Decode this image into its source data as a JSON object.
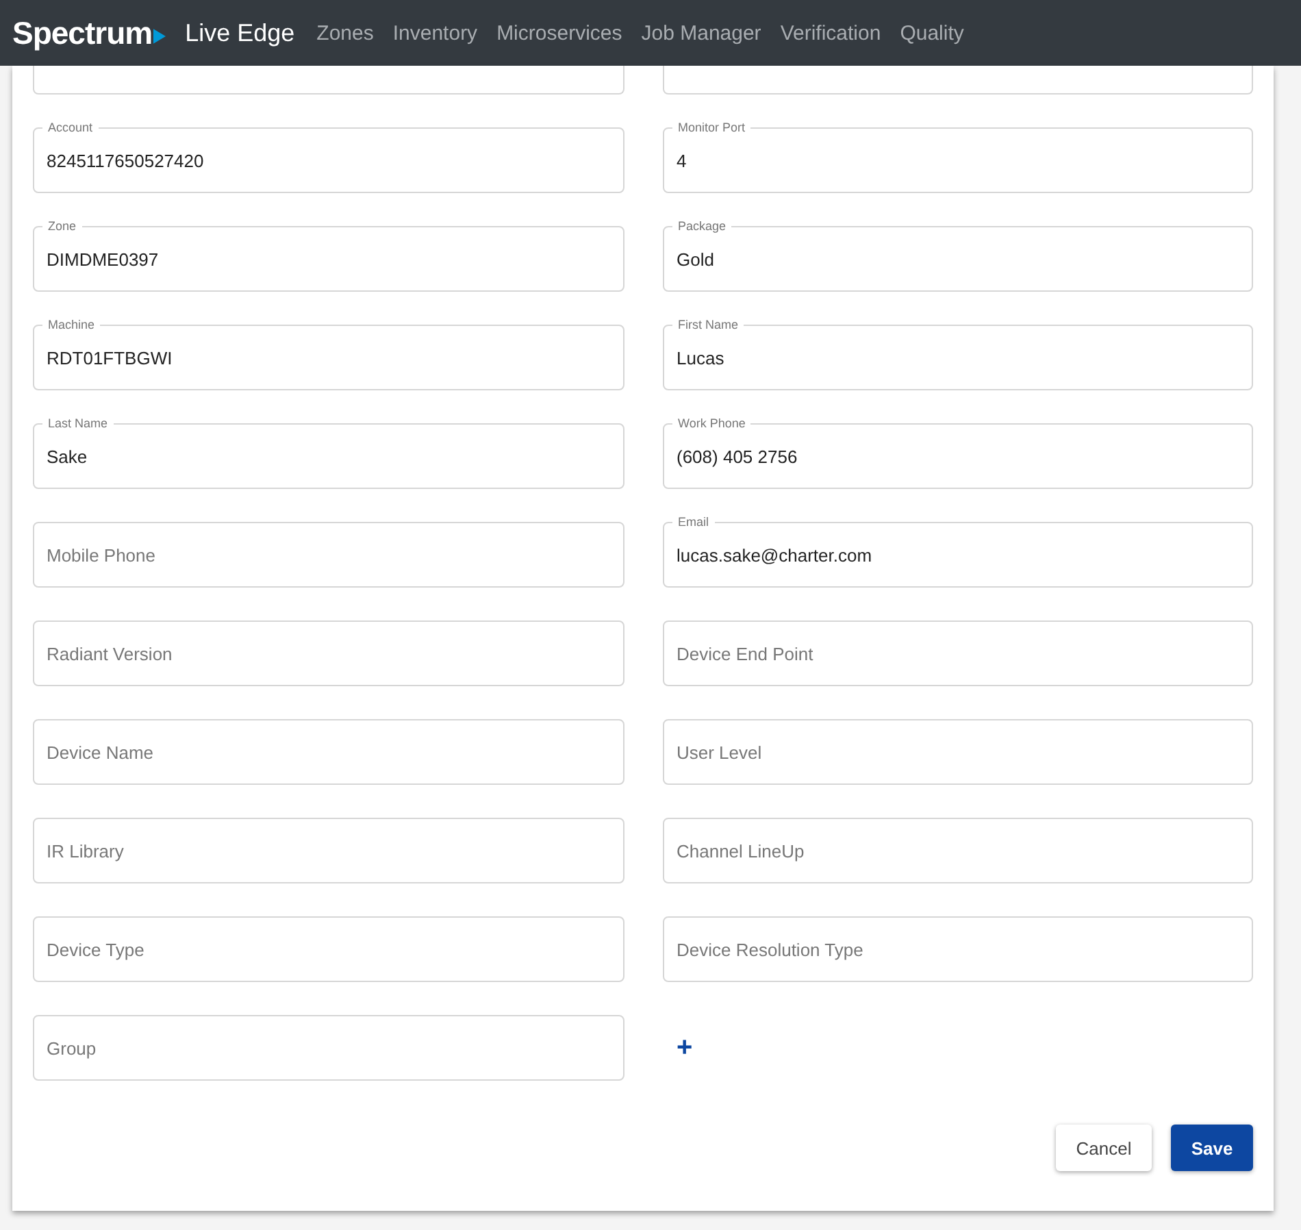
{
  "navbar": {
    "brand": "Spectrum",
    "app_title": "Live Edge",
    "links": [
      "Zones",
      "Inventory",
      "Microservices",
      "Job Manager",
      "Verification",
      "Quality"
    ]
  },
  "form": {
    "rows": [
      [
        {
          "kind": "cut"
        },
        {
          "kind": "cut"
        }
      ],
      [
        {
          "kind": "filled",
          "label": "Account",
          "value": "8245117650527420"
        },
        {
          "kind": "filled",
          "label": "Monitor Port",
          "value": "4"
        }
      ],
      [
        {
          "kind": "filled",
          "label": "Zone",
          "value": "DIMDME0397"
        },
        {
          "kind": "filled",
          "label": "Package",
          "value": "Gold"
        }
      ],
      [
        {
          "kind": "filled",
          "label": "Machine",
          "value": "RDT01FTBGWI"
        },
        {
          "kind": "filled",
          "label": "First Name",
          "value": "Lucas"
        }
      ],
      [
        {
          "kind": "filled",
          "label": "Last Name",
          "value": "Sake"
        },
        {
          "kind": "filled",
          "label": "Work Phone",
          "value": "(608) 405 2756"
        }
      ],
      [
        {
          "kind": "empty",
          "placeholder": "Mobile Phone"
        },
        {
          "kind": "filled",
          "label": "Email",
          "value": "lucas.sake@charter.com"
        }
      ],
      [
        {
          "kind": "empty",
          "placeholder": "Radiant Version"
        },
        {
          "kind": "empty",
          "placeholder": "Device End Point"
        }
      ],
      [
        {
          "kind": "empty",
          "placeholder": "Device Name"
        },
        {
          "kind": "empty",
          "placeholder": "User Level"
        }
      ],
      [
        {
          "kind": "empty",
          "placeholder": "IR Library"
        },
        {
          "kind": "empty",
          "placeholder": "Channel LineUp"
        }
      ],
      [
        {
          "kind": "empty",
          "placeholder": "Device Type"
        },
        {
          "kind": "empty",
          "placeholder": "Device Resolution Type"
        }
      ],
      [
        {
          "kind": "empty",
          "placeholder": "Group"
        }
      ]
    ],
    "add_symbol": "+",
    "buttons": [
      {
        "label": "Cancel",
        "kind": "secondary"
      },
      {
        "label": "Save",
        "kind": "primary"
      }
    ]
  }
}
